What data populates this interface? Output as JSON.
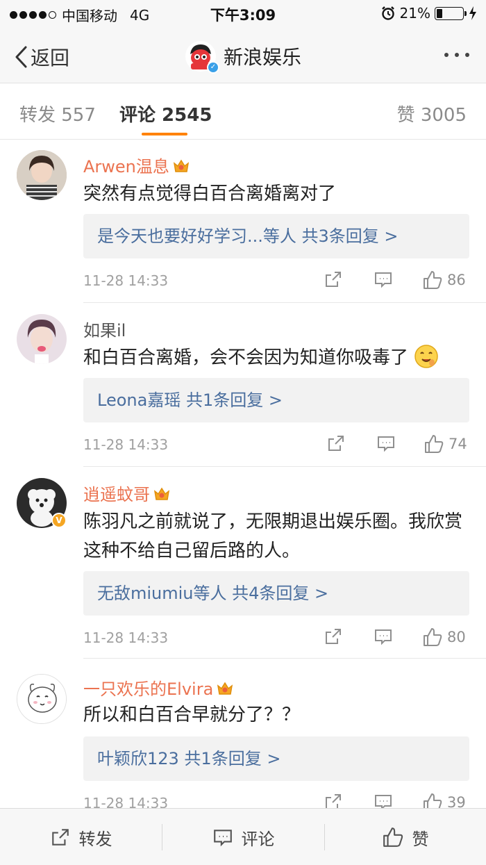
{
  "status_bar": {
    "carrier": "中国移动",
    "network": "4G",
    "time": "下午3:09",
    "battery_text": "21%",
    "battery_level": 0.21
  },
  "navbar": {
    "back_label": "返回",
    "title": "新浪娱乐"
  },
  "tabs": {
    "repost": "转发 557",
    "comments": "评论 2545",
    "likes": "赞 3005"
  },
  "comments": [
    {
      "name": "Arwen温息",
      "vip": true,
      "text": "突然有点觉得白百合离婚离对了",
      "replies": "是今天也要好好学习...等人  共3条回复 >",
      "date": "11-28 14:33",
      "likes": "86"
    },
    {
      "name": "如果il",
      "vip": false,
      "text": "和白百合离婚，会不会因为知道你吸毒了",
      "replies": "Leona嘉瑶  共1条回复 >",
      "date": "11-28 14:33",
      "likes": "74"
    },
    {
      "name": "逍遥蚊哥",
      "vip": true,
      "text": "陈羽凡之前就说了，无限期退出娱乐圈。我欣赏这种不给自己留后路的人。",
      "replies": "无敌miumiu等人  共4条回复 >",
      "date": "11-28 14:33",
      "likes": "80"
    },
    {
      "name": "一只欢乐的Elvira",
      "vip": true,
      "text": "所以和白百合早就分了？？",
      "replies": "叶颖欣123  共1条回复 >",
      "date": "11-28 14:33",
      "likes": "39"
    }
  ],
  "toolbar": {
    "repost": "转发",
    "comment": "评论",
    "like": "赞"
  },
  "colors": {
    "accent": "#ff8200",
    "vip_name": "#eb7350",
    "link": "#4a6e9e"
  }
}
